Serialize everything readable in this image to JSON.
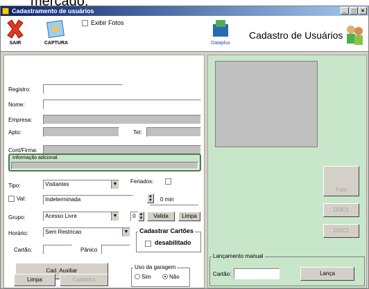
{
  "header_text": "mercado.",
  "window": {
    "title": "Cadastramento de usuários",
    "min": "_",
    "max": "□",
    "close": "×"
  },
  "toolbar": {
    "sair": "SAIR",
    "captura": "CAPTURA",
    "exibir_fotos": "Exibir Fotos",
    "dataplus": "Dataplus",
    "heading": "Cadastro de Usuários"
  },
  "form": {
    "registro": "Registro:",
    "nome": "Nome:",
    "empresa": "Empresa:",
    "apto": "Apto:",
    "tel": "Tel:",
    "cont_firma": "Cont/Firma:",
    "info_adicional": "Informação adicional",
    "tipo": "Tipo:",
    "tipo_value": "Visitantes",
    "feriados": "Feriados:",
    "val": "Val:",
    "val_value": "Indeterminada",
    "spin_value": "0",
    "min_label": "0 min",
    "grupo": "Grupo:",
    "grupo_value": "Acesso Livre",
    "grupo_spin": "0",
    "valida": "Valida",
    "limpa_small": "Limpa",
    "horario": "Horário:",
    "horario_value": "Sem Restricao",
    "cadastrar_cartoes": "Cadastrar Cartões",
    "desabilitado": "desabilitado",
    "cartao": "Cartão:",
    "panico": "Pânico"
  },
  "bottom": {
    "cad_auxiliar": "Cad. Auxiliar",
    "limpa": "Limpa",
    "cadastra": "Cadastra",
    "uso_garagem": "Uso da garagem",
    "sim": "Sim",
    "nao": "Não"
  },
  "right": {
    "foto": "Foto",
    "doc1": "DOC1",
    "doc2": "DOC2",
    "lancamento_manual": "Lançamento manual",
    "cartao": "Cartão:",
    "lanca": "Lança"
  }
}
